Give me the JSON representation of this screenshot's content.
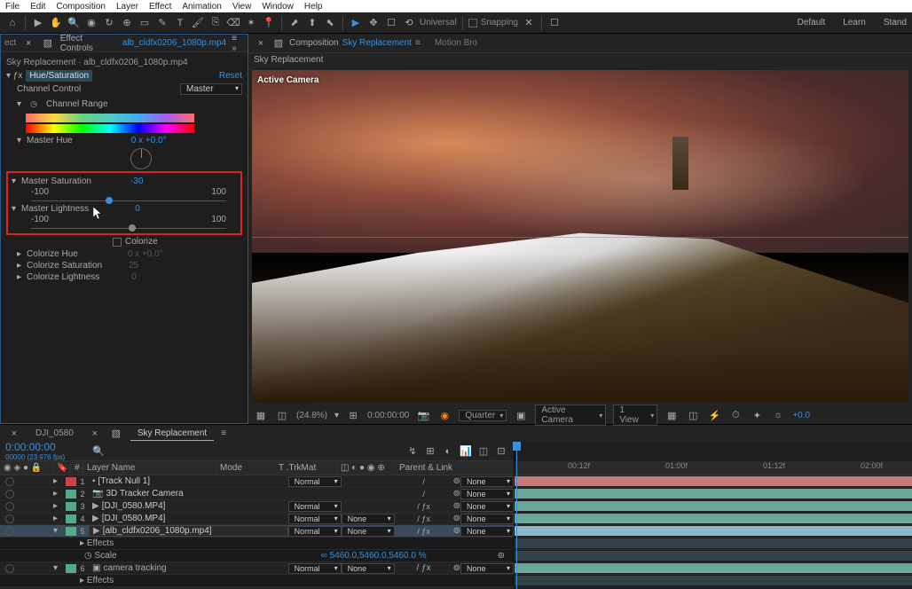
{
  "menubar": [
    "File",
    "Edit",
    "Composition",
    "Layer",
    "Effect",
    "Animation",
    "View",
    "Window",
    "Help"
  ],
  "toolbar_right": [
    "Default",
    "Learn",
    "Stand"
  ],
  "toolbar_mid": {
    "universal": "Universal",
    "snapping": "Snapping"
  },
  "effect_panel": {
    "tab_prefix": "Effect Controls",
    "tab_file": "alb_cldfx0206_1080p.mp4",
    "breadcrumb": "Sky Replacement · alb_cldfx0206_1080p.mp4",
    "fx_name": "Hue/Saturation",
    "reset": "Reset",
    "channel_control_label": "Channel Control",
    "channel_control_value": "Master",
    "channel_range": "Channel Range",
    "master_hue": "Master Hue",
    "master_hue_val": "0 x +0.0°",
    "master_sat": "Master Saturation",
    "master_sat_val": "-30",
    "master_light": "Master Lightness",
    "master_light_val": "0",
    "range_min": "-100",
    "range_max": "100",
    "colorize": "Colorize",
    "colorize_hue": "Colorize Hue",
    "colorize_hue_val": "0 x +0.0°",
    "colorize_sat": "Colorize Saturation",
    "colorize_sat_val": "25",
    "colorize_light": "Colorize Lightness",
    "colorize_light_val": "0"
  },
  "composition": {
    "label": "Composition",
    "name": "Sky Replacement",
    "tab2": "Motion Bro",
    "sub_tab": "Sky Replacement",
    "active_camera": "Active Camera"
  },
  "viewer_footer": {
    "zoom": "(24.8%)",
    "time": "0:00:00:00",
    "quality": "Quarter",
    "camera": "Active Camera",
    "view": "1 View",
    "exposure": "+0.0"
  },
  "comp_tabs": {
    "t1": "DJI_0580",
    "t2": "Sky Replacement"
  },
  "timeline": {
    "timecode": "0:00:00:00",
    "timecode_sub": "00000 (23.976 fps)",
    "cols": {
      "layer": "Layer Name",
      "mode": "Mode",
      "trkmat": "T .TrkMat",
      "parent": "Parent & Link"
    },
    "layers": [
      {
        "num": "1",
        "color": "#c44",
        "name": "[Track Null 1]",
        "mode": "Normal",
        "parent": "None",
        "icon": "layer"
      },
      {
        "num": "2",
        "color": "#5a8",
        "name": "3D Tracker Camera",
        "mode": "",
        "parent": "None",
        "icon": "camera"
      },
      {
        "num": "3",
        "color": "#5a8",
        "name": "[DJI_0580.MP4]",
        "mode": "Normal",
        "parent": "None",
        "icon": "video"
      },
      {
        "num": "4",
        "color": "#5a8",
        "name": "[DJI_0580.MP4]",
        "mode": "Normal",
        "trk": "None",
        "parent": "None",
        "icon": "video"
      },
      {
        "num": "5",
        "color": "#5a8",
        "name": "[alb_cldfx0206_1080p.mp4]",
        "mode": "Normal",
        "trk": "None",
        "parent": "None",
        "icon": "video",
        "selected": true
      }
    ],
    "sublayers": {
      "effects": "Effects",
      "scale": "Scale",
      "scale_val": "∞ 5460.0,5460.0,5460.0 %",
      "camtrack": "camera tracking",
      "ct_mode": "Normal",
      "ct_trk": "None",
      "ct_parent": "None",
      "ct_num": "6",
      "effects2": "Effects"
    },
    "ruler": [
      "00:12f",
      "01:00f",
      "01:12f",
      "02:00f"
    ]
  }
}
